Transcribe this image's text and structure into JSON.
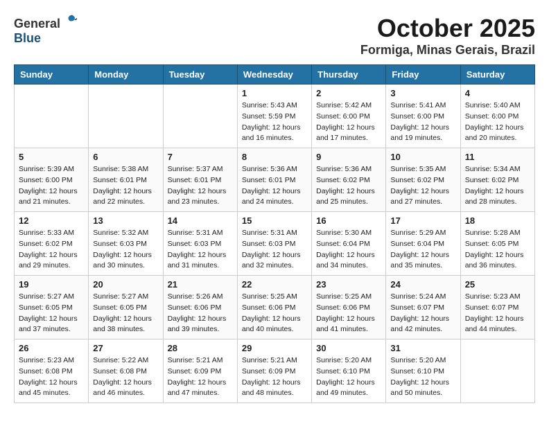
{
  "header": {
    "logo_general": "General",
    "logo_blue": "Blue",
    "month_title": "October 2025",
    "location": "Formiga, Minas Gerais, Brazil"
  },
  "weekdays": [
    "Sunday",
    "Monday",
    "Tuesday",
    "Wednesday",
    "Thursday",
    "Friday",
    "Saturday"
  ],
  "weeks": [
    [
      null,
      null,
      null,
      {
        "day": "1",
        "sunrise": "Sunrise: 5:43 AM",
        "sunset": "Sunset: 5:59 PM",
        "daylight": "Daylight: 12 hours and 16 minutes."
      },
      {
        "day": "2",
        "sunrise": "Sunrise: 5:42 AM",
        "sunset": "Sunset: 6:00 PM",
        "daylight": "Daylight: 12 hours and 17 minutes."
      },
      {
        "day": "3",
        "sunrise": "Sunrise: 5:41 AM",
        "sunset": "Sunset: 6:00 PM",
        "daylight": "Daylight: 12 hours and 19 minutes."
      },
      {
        "day": "4",
        "sunrise": "Sunrise: 5:40 AM",
        "sunset": "Sunset: 6:00 PM",
        "daylight": "Daylight: 12 hours and 20 minutes."
      }
    ],
    [
      {
        "day": "5",
        "sunrise": "Sunrise: 5:39 AM",
        "sunset": "Sunset: 6:00 PM",
        "daylight": "Daylight: 12 hours and 21 minutes."
      },
      {
        "day": "6",
        "sunrise": "Sunrise: 5:38 AM",
        "sunset": "Sunset: 6:01 PM",
        "daylight": "Daylight: 12 hours and 22 minutes."
      },
      {
        "day": "7",
        "sunrise": "Sunrise: 5:37 AM",
        "sunset": "Sunset: 6:01 PM",
        "daylight": "Daylight: 12 hours and 23 minutes."
      },
      {
        "day": "8",
        "sunrise": "Sunrise: 5:36 AM",
        "sunset": "Sunset: 6:01 PM",
        "daylight": "Daylight: 12 hours and 24 minutes."
      },
      {
        "day": "9",
        "sunrise": "Sunrise: 5:36 AM",
        "sunset": "Sunset: 6:02 PM",
        "daylight": "Daylight: 12 hours and 25 minutes."
      },
      {
        "day": "10",
        "sunrise": "Sunrise: 5:35 AM",
        "sunset": "Sunset: 6:02 PM",
        "daylight": "Daylight: 12 hours and 27 minutes."
      },
      {
        "day": "11",
        "sunrise": "Sunrise: 5:34 AM",
        "sunset": "Sunset: 6:02 PM",
        "daylight": "Daylight: 12 hours and 28 minutes."
      }
    ],
    [
      {
        "day": "12",
        "sunrise": "Sunrise: 5:33 AM",
        "sunset": "Sunset: 6:02 PM",
        "daylight": "Daylight: 12 hours and 29 minutes."
      },
      {
        "day": "13",
        "sunrise": "Sunrise: 5:32 AM",
        "sunset": "Sunset: 6:03 PM",
        "daylight": "Daylight: 12 hours and 30 minutes."
      },
      {
        "day": "14",
        "sunrise": "Sunrise: 5:31 AM",
        "sunset": "Sunset: 6:03 PM",
        "daylight": "Daylight: 12 hours and 31 minutes."
      },
      {
        "day": "15",
        "sunrise": "Sunrise: 5:31 AM",
        "sunset": "Sunset: 6:03 PM",
        "daylight": "Daylight: 12 hours and 32 minutes."
      },
      {
        "day": "16",
        "sunrise": "Sunrise: 5:30 AM",
        "sunset": "Sunset: 6:04 PM",
        "daylight": "Daylight: 12 hours and 34 minutes."
      },
      {
        "day": "17",
        "sunrise": "Sunrise: 5:29 AM",
        "sunset": "Sunset: 6:04 PM",
        "daylight": "Daylight: 12 hours and 35 minutes."
      },
      {
        "day": "18",
        "sunrise": "Sunrise: 5:28 AM",
        "sunset": "Sunset: 6:05 PM",
        "daylight": "Daylight: 12 hours and 36 minutes."
      }
    ],
    [
      {
        "day": "19",
        "sunrise": "Sunrise: 5:27 AM",
        "sunset": "Sunset: 6:05 PM",
        "daylight": "Daylight: 12 hours and 37 minutes."
      },
      {
        "day": "20",
        "sunrise": "Sunrise: 5:27 AM",
        "sunset": "Sunset: 6:05 PM",
        "daylight": "Daylight: 12 hours and 38 minutes."
      },
      {
        "day": "21",
        "sunrise": "Sunrise: 5:26 AM",
        "sunset": "Sunset: 6:06 PM",
        "daylight": "Daylight: 12 hours and 39 minutes."
      },
      {
        "day": "22",
        "sunrise": "Sunrise: 5:25 AM",
        "sunset": "Sunset: 6:06 PM",
        "daylight": "Daylight: 12 hours and 40 minutes."
      },
      {
        "day": "23",
        "sunrise": "Sunrise: 5:25 AM",
        "sunset": "Sunset: 6:06 PM",
        "daylight": "Daylight: 12 hours and 41 minutes."
      },
      {
        "day": "24",
        "sunrise": "Sunrise: 5:24 AM",
        "sunset": "Sunset: 6:07 PM",
        "daylight": "Daylight: 12 hours and 42 minutes."
      },
      {
        "day": "25",
        "sunrise": "Sunrise: 5:23 AM",
        "sunset": "Sunset: 6:07 PM",
        "daylight": "Daylight: 12 hours and 44 minutes."
      }
    ],
    [
      {
        "day": "26",
        "sunrise": "Sunrise: 5:23 AM",
        "sunset": "Sunset: 6:08 PM",
        "daylight": "Daylight: 12 hours and 45 minutes."
      },
      {
        "day": "27",
        "sunrise": "Sunrise: 5:22 AM",
        "sunset": "Sunset: 6:08 PM",
        "daylight": "Daylight: 12 hours and 46 minutes."
      },
      {
        "day": "28",
        "sunrise": "Sunrise: 5:21 AM",
        "sunset": "Sunset: 6:09 PM",
        "daylight": "Daylight: 12 hours and 47 minutes."
      },
      {
        "day": "29",
        "sunrise": "Sunrise: 5:21 AM",
        "sunset": "Sunset: 6:09 PM",
        "daylight": "Daylight: 12 hours and 48 minutes."
      },
      {
        "day": "30",
        "sunrise": "Sunrise: 5:20 AM",
        "sunset": "Sunset: 6:10 PM",
        "daylight": "Daylight: 12 hours and 49 minutes."
      },
      {
        "day": "31",
        "sunrise": "Sunrise: 5:20 AM",
        "sunset": "Sunset: 6:10 PM",
        "daylight": "Daylight: 12 hours and 50 minutes."
      },
      null
    ]
  ]
}
